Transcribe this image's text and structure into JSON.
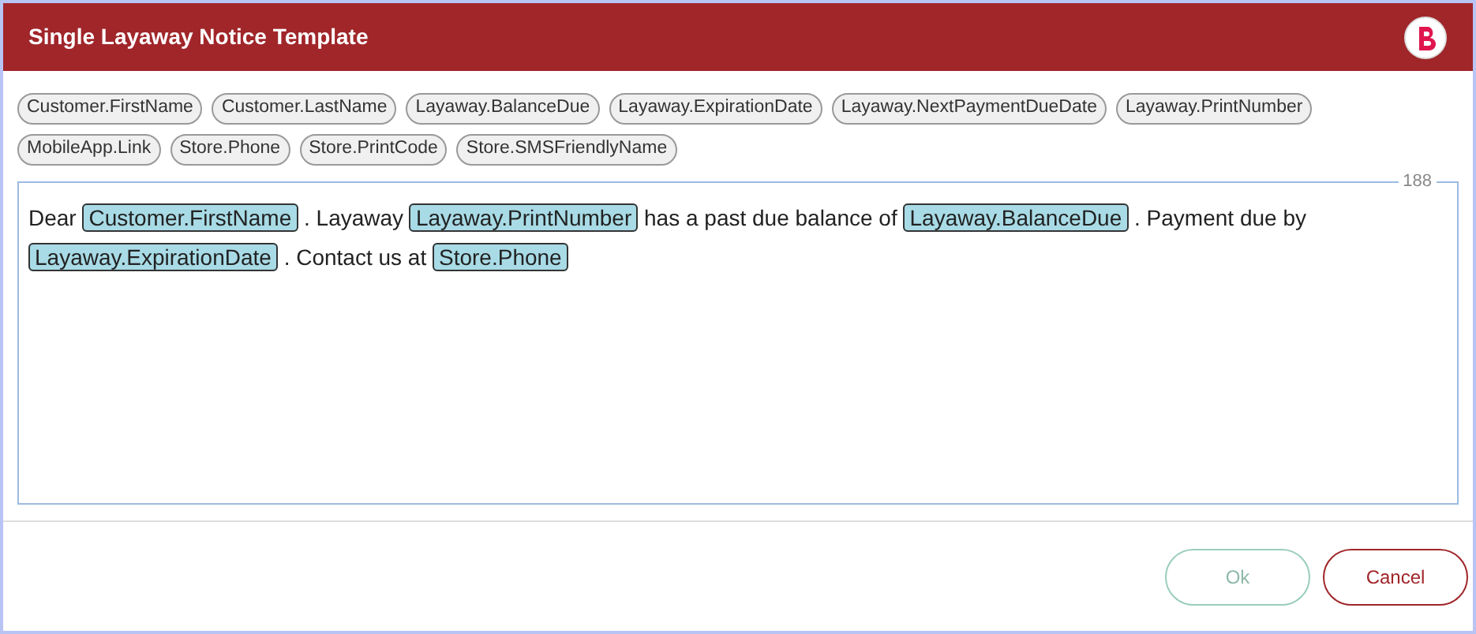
{
  "window": {
    "title": "Single Layaway Notice Template"
  },
  "fields": [
    "Customer.FirstName",
    "Customer.LastName",
    "Layaway.BalanceDue",
    "Layaway.ExpirationDate",
    "Layaway.NextPaymentDueDate",
    "Layaway.PrintNumber",
    "MobileApp.Link",
    "Store.Phone",
    "Store.PrintCode",
    "Store.SMSFriendlyName"
  ],
  "editor": {
    "counter": "188",
    "segments": [
      {
        "kind": "text",
        "text": "Dear"
      },
      {
        "kind": "token",
        "text": "Customer.FirstName"
      },
      {
        "kind": "text",
        "text": ". Layaway"
      },
      {
        "kind": "token",
        "text": "Layaway.PrintNumber"
      },
      {
        "kind": "text",
        "text": "has a past due balance of"
      },
      {
        "kind": "token",
        "text": "Layaway.BalanceDue"
      },
      {
        "kind": "text",
        "text": ". Payment due by"
      },
      {
        "kind": "token",
        "text": "Layaway.ExpirationDate"
      },
      {
        "kind": "text",
        "text": ". Contact us at"
      },
      {
        "kind": "token",
        "text": "Store.Phone"
      }
    ]
  },
  "buttons": [
    {
      "kind": "ok",
      "label": "Ok",
      "disabled": true
    },
    {
      "kind": "cancel",
      "label": "Cancel",
      "disabled": false
    }
  ]
}
